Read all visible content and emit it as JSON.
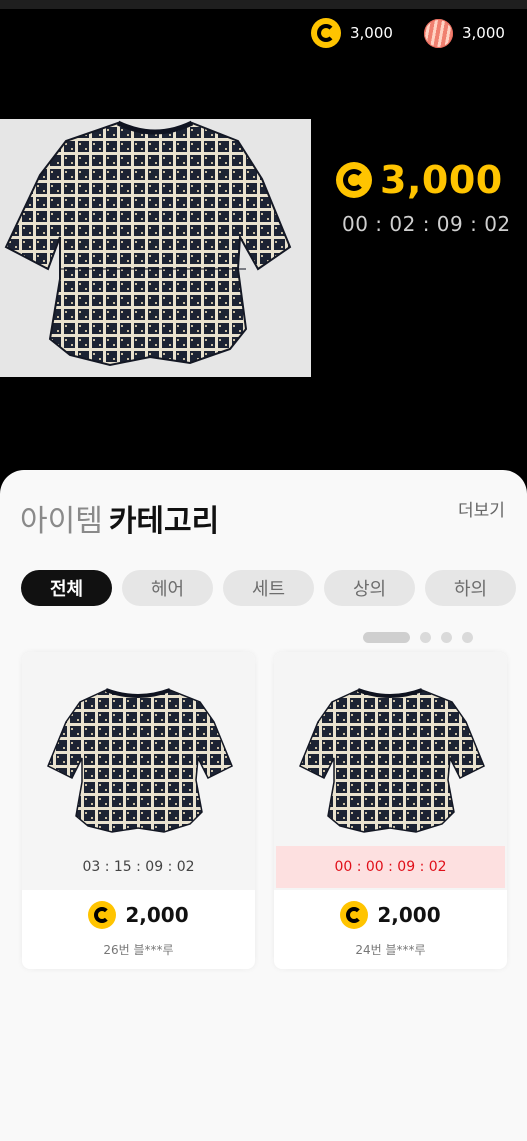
{
  "wallet": {
    "coin_value": "3,000",
    "gem_value": "3,000"
  },
  "featured": {
    "price": "3,000",
    "timer": "00 : 02 : 09 : 02"
  },
  "section": {
    "title_light": "아이템",
    "title_bold": "카테고리",
    "more_label": "더보기"
  },
  "categories": [
    "전체",
    "헤어",
    "세트",
    "상의",
    "하의"
  ],
  "active_category_index": 0,
  "pagination": {
    "total": 4,
    "active": 0
  },
  "items": [
    {
      "timer": "03 : 15 : 09 : 02",
      "urgent": false,
      "price": "2,000",
      "bidder": "26번 블***루"
    },
    {
      "timer": "00 : 00 : 09 : 02",
      "urgent": true,
      "price": "2,000",
      "bidder": "24번 블***루"
    }
  ],
  "colors": {
    "accent": "#ffc400",
    "urgent": "#e0101a",
    "urgent_bg": "#fde0e0",
    "shirt": "#1c2333"
  }
}
